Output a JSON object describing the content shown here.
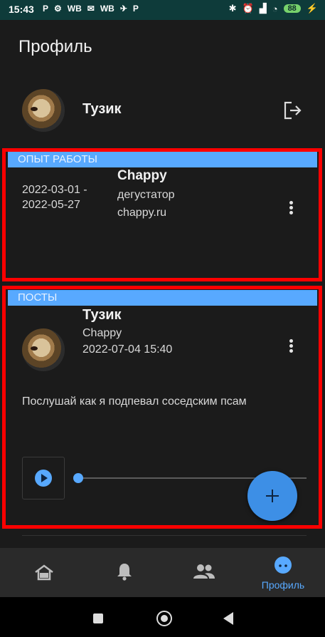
{
  "status_bar": {
    "time": "15:43",
    "left_items": [
      "P",
      "⚙",
      "WB",
      "✉",
      "WB",
      "✈",
      "P"
    ],
    "battery": "88"
  },
  "header": {
    "title": "Профиль"
  },
  "profile": {
    "name": "Тузик"
  },
  "experience": {
    "section_title": "ОПЫТ РАБОТЫ",
    "item": {
      "date_start": "2022-03-01 -",
      "date_end": "2022-05-27",
      "company": "Chappy",
      "role": "дегустатор",
      "site": "chappy.ru"
    }
  },
  "posts": {
    "section_title": "ПОСТЫ",
    "item": {
      "author": "Тузик",
      "company": "Chappy",
      "datetime": "2022-07-04 15:40",
      "text": "Послушай как я подпевал соседским псам",
      "audio_progress": 0
    }
  },
  "bottom_nav": {
    "items": [
      {
        "icon": "home-icon"
      },
      {
        "icon": "bell-icon"
      },
      {
        "icon": "people-icon"
      },
      {
        "icon": "face-icon",
        "label": "Профиль",
        "active": true
      }
    ]
  },
  "colors": {
    "accent": "#58a9ff",
    "highlight": "#ff0000",
    "background": "#1b1b1b"
  }
}
